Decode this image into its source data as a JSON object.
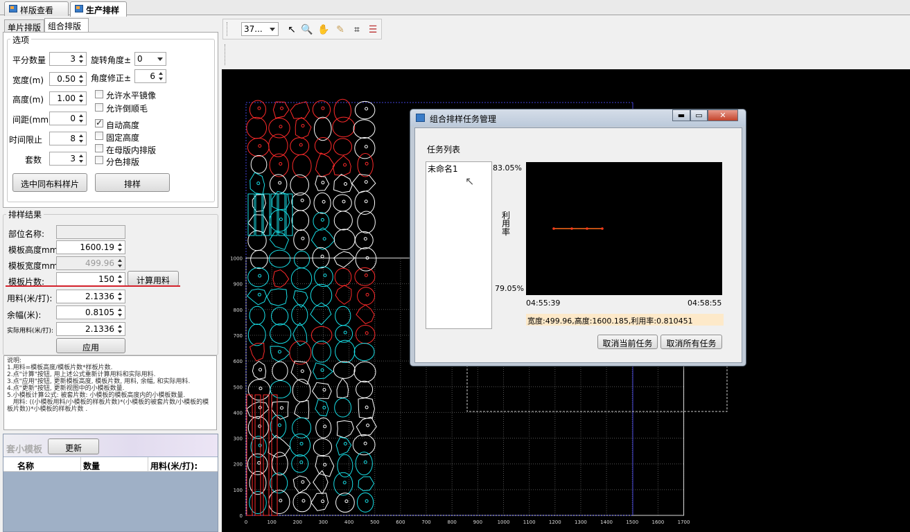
{
  "doc_tabs": [
    "样版查看",
    "生产排样"
  ],
  "sub_tabs": [
    "单片排版",
    "组合排版"
  ],
  "options": {
    "legend": "选项",
    "rows": [
      {
        "label": "平分数量",
        "value": "3"
      },
      {
        "label": "宽度(m)",
        "value": "0.50"
      },
      {
        "label": "高度(m)",
        "value": "1.00"
      },
      {
        "label": "间距(mm)",
        "value": "0"
      },
      {
        "label": "时间限止",
        "value": "8"
      },
      {
        "label": "套数",
        "value": "3"
      }
    ],
    "rotate_label": "旋转角度±",
    "rotate_value": "0",
    "angle_label": "角度修正±",
    "angle_value": "6",
    "checks": [
      {
        "label": "允许水平镜像",
        "checked": false
      },
      {
        "label": "允许倒顺毛",
        "checked": false
      },
      {
        "label": "自动高度",
        "checked": true
      },
      {
        "label": "固定高度",
        "checked": false
      },
      {
        "label": "在母版内排版",
        "checked": false
      },
      {
        "label": "分色排版",
        "checked": false
      }
    ],
    "btn_select": "选中同布料样片",
    "btn_nest": "排样"
  },
  "result": {
    "legend": "排样结果",
    "part_label": "部位名称:",
    "part_value": "",
    "height_label": "模板高度mm:",
    "height_value": "1600.19",
    "width_label": "模板宽度mm:",
    "width_value": "499.96",
    "count_label": "模板片数:",
    "count_value": "150",
    "calc_btn": "计算用料",
    "usage_label": "用料(米/打):",
    "usage_value": "2.1336",
    "remain_label": "余幅(米):",
    "remain_value": "0.8105",
    "actual_label": "实际用料(米/打):",
    "actual_value": "2.1336",
    "apply_btn": "应用"
  },
  "note": "说明:\n1.用料=模板高度/模板片数*样板片数.\n2.点\"计算\"按钮, 用上述公式重新计算用料和实际用料.\n3.点\"应用\"按钮, 更新模板高度, 模板片数, 用料, 余幅, 和实际用料.\n4.点\"更新\"按钮, 更新视图中的小模板数量.\n5.小模板计算公式: 被套片数: 小模板的模板高度内的小模板数量.\n   用料: ((小模板用料/小模板的样板片数)*(小模板的被套片数/小模板的模板片数))*小模板的样板片数 .",
  "small": {
    "title": "套小模板",
    "refresh": "更新",
    "cols": [
      "名称",
      "数量",
      "用料(米/打):"
    ]
  },
  "toolbar": {
    "zoom": "37...",
    "icons": [
      "pointer-icon",
      "zoom-icon",
      "hand-icon",
      "eraser-icon",
      "crop-icon",
      "list-icon"
    ]
  },
  "axis": {
    "y": [
      "1000",
      "900",
      "800",
      "700",
      "600",
      "500",
      "400",
      "300",
      "200",
      "100",
      "0"
    ],
    "x": [
      "0",
      "100",
      "200",
      "300",
      "400",
      "500",
      "600",
      "700",
      "800",
      "900",
      "1000",
      "1100",
      "1200",
      "1300",
      "1400",
      "1500",
      "1600",
      "1700"
    ]
  },
  "dialog": {
    "title": "组合排样任务管理",
    "list_label": "任务列表",
    "tasks": [
      "未命名1"
    ],
    "ymax": "83.05%",
    "ymin": "79.05%",
    "ylabel": "利用率",
    "tstart": "04:55:39",
    "tend": "04:58:55",
    "status": "宽度:499.96,高度:1600.185,利用率:0.810451",
    "btn_cancel_cur": "取消当前任务",
    "btn_cancel_all": "取消所有任务"
  }
}
